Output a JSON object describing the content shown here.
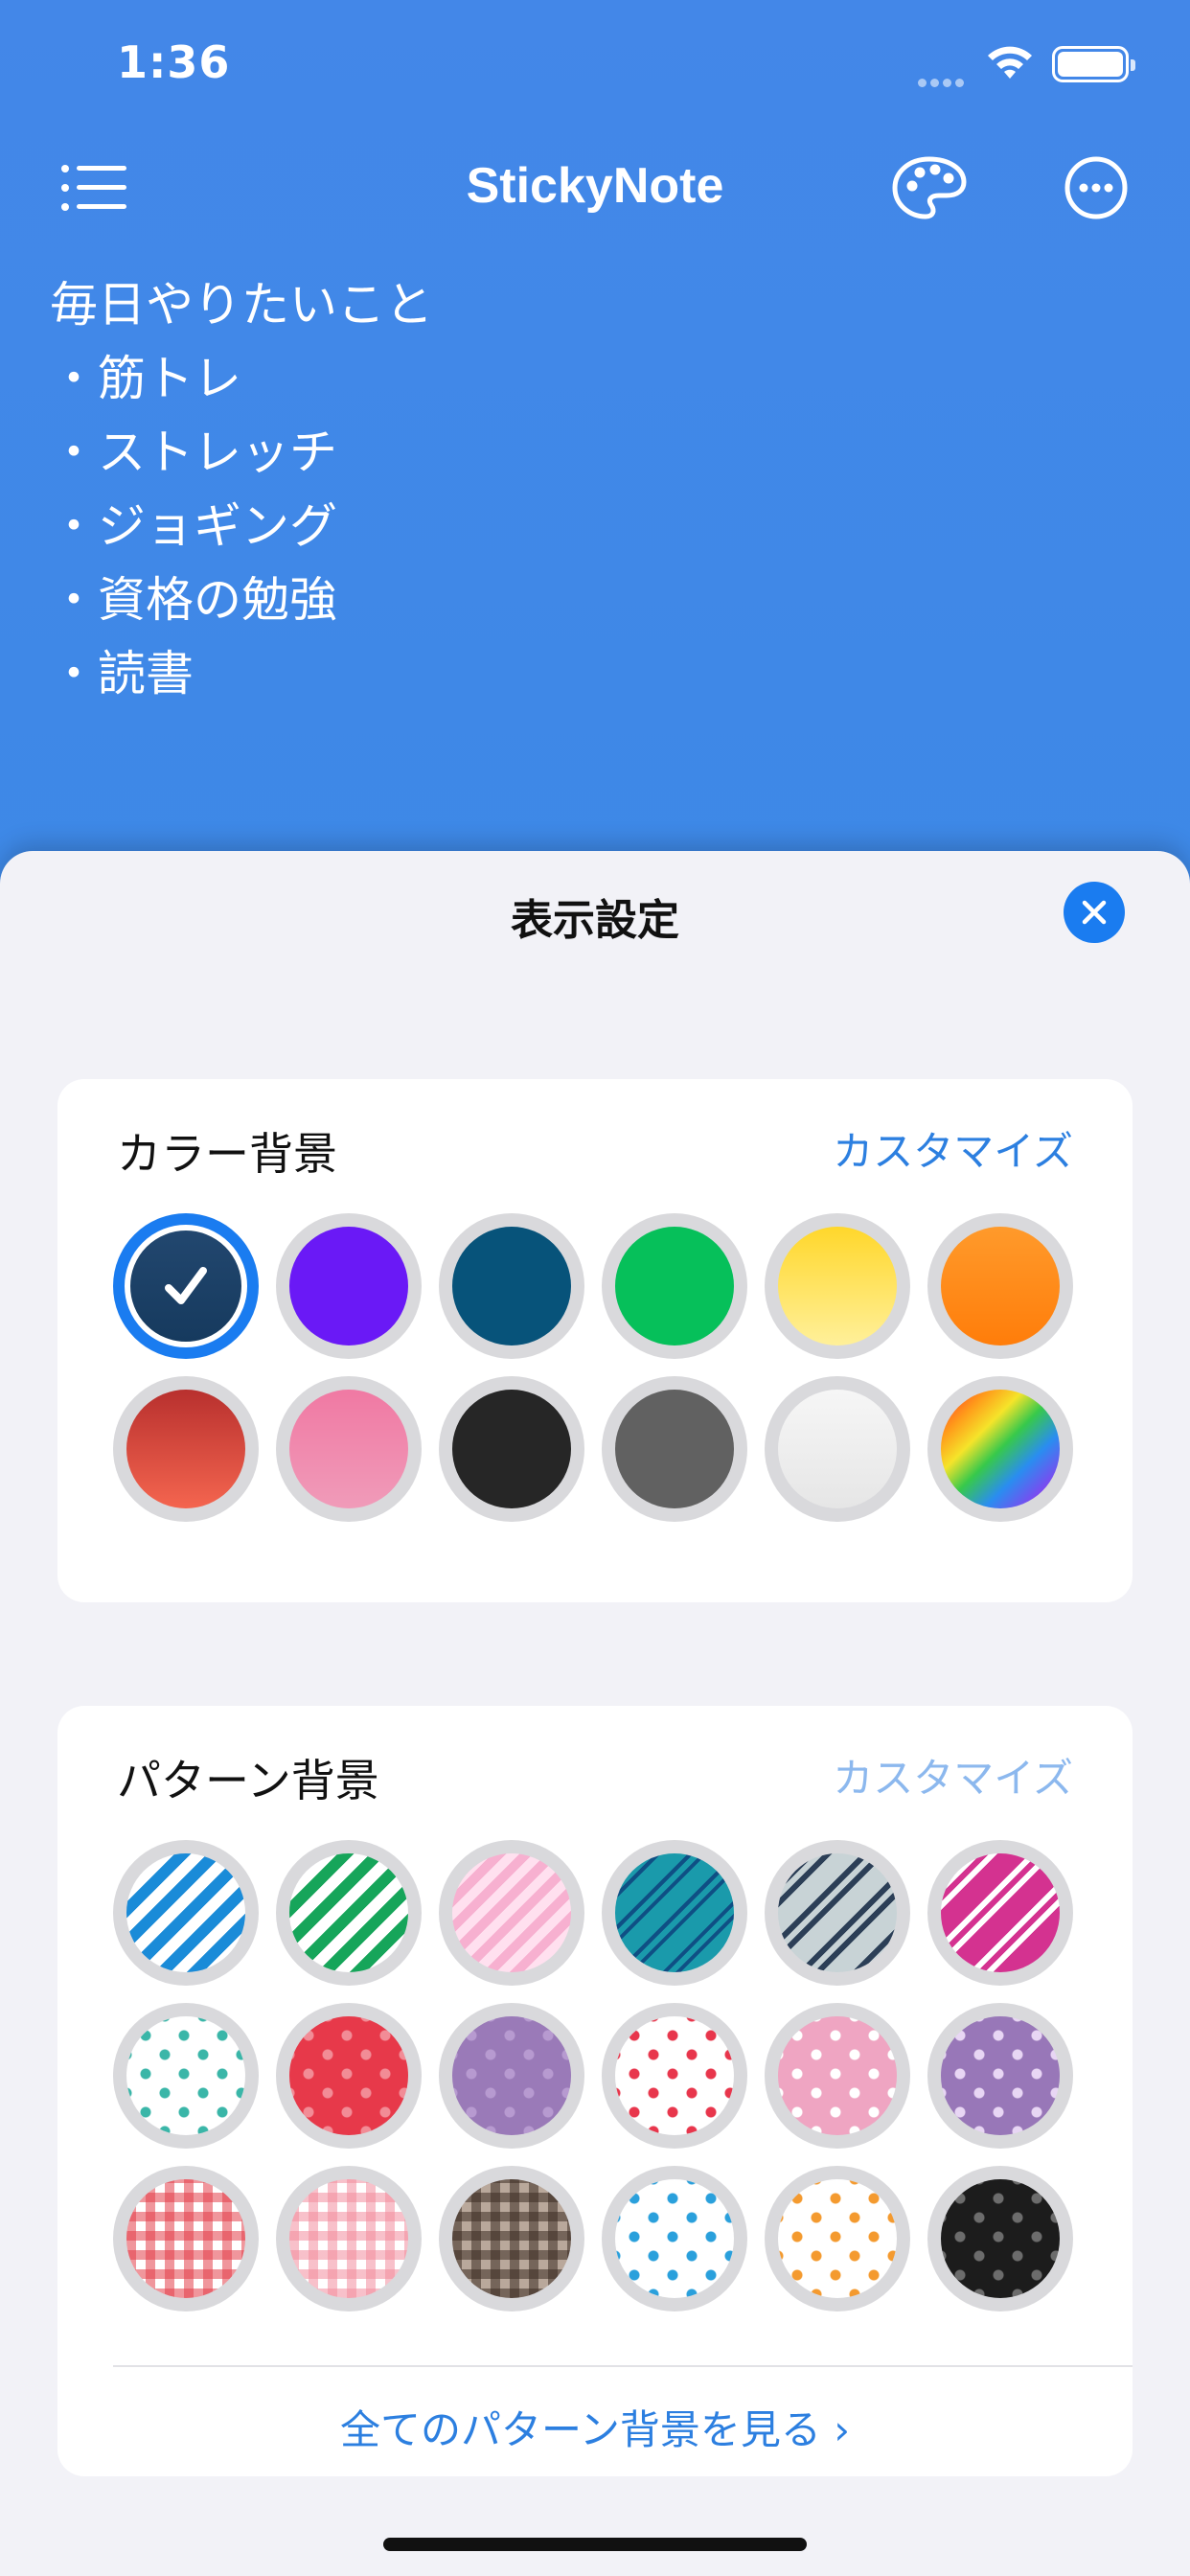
{
  "status": {
    "time": "1:36"
  },
  "nav": {
    "title": "StickyNote"
  },
  "note": {
    "lines": [
      "毎日やりたいこと",
      "・筋トレ",
      "・ストレッチ",
      "・ジョギング",
      "・資格の勉強",
      "・読書"
    ]
  },
  "sheet": {
    "title": "表示設定",
    "color_section": {
      "label": "カラー背景",
      "action": "カスタマイズ",
      "selected": "navy",
      "swatches": [
        "navy",
        "purple",
        "teal-blue",
        "green",
        "yellow",
        "orange",
        "red",
        "pink",
        "black",
        "gray",
        "white",
        "rainbow"
      ]
    },
    "pattern_section": {
      "label": "パターン背景",
      "action": "カスタマイズ",
      "swatches": [
        "stripe-blue",
        "stripe-green",
        "stripe-pink",
        "stripe-teal",
        "stripe-navy-gray",
        "stripe-magenta",
        "dots-teal-white",
        "dots-red",
        "dots-purple",
        "hearts-red-white",
        "hearts-pink",
        "hearts-purple",
        "gingham-red",
        "gingham-pink",
        "gingham-brown",
        "stars-blue-white",
        "stars-orange-white",
        "stars-black"
      ],
      "see_all": "全てのパターン背景を見る ›"
    }
  },
  "colors": {
    "accent": "#1a7cf0",
    "header_blue": "#3f89e7"
  }
}
